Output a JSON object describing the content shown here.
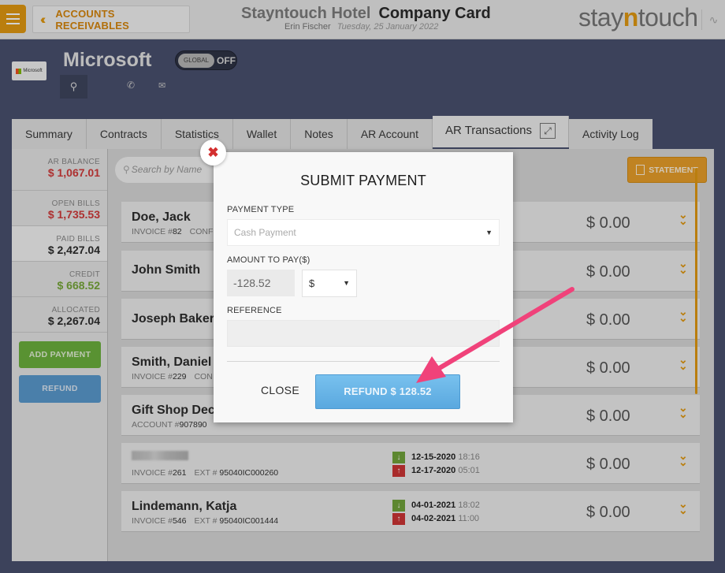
{
  "header": {
    "back_label": "ACCOUNTS RECEIVABLES",
    "hotel": "Stayntouch Hotel",
    "card_title": "Company Card",
    "user": "Erin Fischer",
    "date": "Tuesday, 25 January 2022",
    "brand_pre": "stay",
    "brand_n": "n",
    "brand_post": "touch"
  },
  "company": {
    "logo_text": "Microsoft",
    "name": "Microsoft",
    "global_label": "GLOBAL",
    "global_state": "OFF"
  },
  "tabs": [
    {
      "label": "Summary"
    },
    {
      "label": "Contracts"
    },
    {
      "label": "Statistics"
    },
    {
      "label": "Wallet"
    },
    {
      "label": "Notes"
    },
    {
      "label": "AR Account"
    },
    {
      "label": "AR Transactions"
    },
    {
      "label": "Activity Log"
    }
  ],
  "sidebar": {
    "stats": [
      {
        "label": "AR BALANCE",
        "value": "$ 1,067.01"
      },
      {
        "label": "OPEN BILLS",
        "value": "$ 1,735.53"
      },
      {
        "label": "PAID BILLS",
        "value": "$ 2,427.04"
      },
      {
        "label": "CREDIT",
        "value": "$ 668.52"
      },
      {
        "label": "ALLOCATED",
        "value": "$ 2,267.04"
      }
    ],
    "add_payment": "ADD PAYMENT",
    "refund": "REFUND"
  },
  "search": {
    "placeholder": "Search by Name"
  },
  "statement_label": "STATEMENT",
  "rows": [
    {
      "name": "Doe, Jack",
      "meta_label": "INVOICE #",
      "meta_value": "82",
      "extra": "CONF",
      "amount": "$ 0.00"
    },
    {
      "name": "John Smith",
      "amount": "$ 0.00"
    },
    {
      "name": "Joseph Baker",
      "amount": "$ 0.00"
    },
    {
      "name": "Smith, Daniel",
      "meta_label": "INVOICE #",
      "meta_value": "229",
      "extra": "CON",
      "amount": "$ 0.00"
    },
    {
      "name": "Gift Shop Dec",
      "meta_label": "ACCOUNT #",
      "meta_value": "907890",
      "amount": "$ 0.00"
    },
    {
      "name": "",
      "meta_label": "INVOICE #",
      "meta_value": "261",
      "ext_label": "EXT #",
      "ext_value": "95040IC000260",
      "in_date": "12-15-2020",
      "in_time": "18:16",
      "out_date": "12-17-2020",
      "out_time": "05:01",
      "amount": "$ 0.00"
    },
    {
      "name": "Lindemann, Katja",
      "meta_label": "INVOICE #",
      "meta_value": "546",
      "ext_label": "EXT #",
      "ext_value": "95040IC001444",
      "in_date": "04-01-2021",
      "in_time": "18:02",
      "out_date": "04-02-2021",
      "out_time": "11:00",
      "amount": "$ 0.00"
    }
  ],
  "modal": {
    "title": "SUBMIT PAYMENT",
    "payment_type_label": "PAYMENT TYPE",
    "payment_type_value": "Cash Payment",
    "amount_label": "AMOUNT TO PAY($)",
    "amount_value": "-128.52",
    "currency": "$",
    "reference_label": "REFERENCE",
    "reference_value": "",
    "close_label": "CLOSE",
    "submit_label": "REFUND $ 128.52"
  },
  "colors": {
    "accent": "#e39a12",
    "refund_blue": "#5aa8df",
    "pointer": "#f0427a"
  }
}
